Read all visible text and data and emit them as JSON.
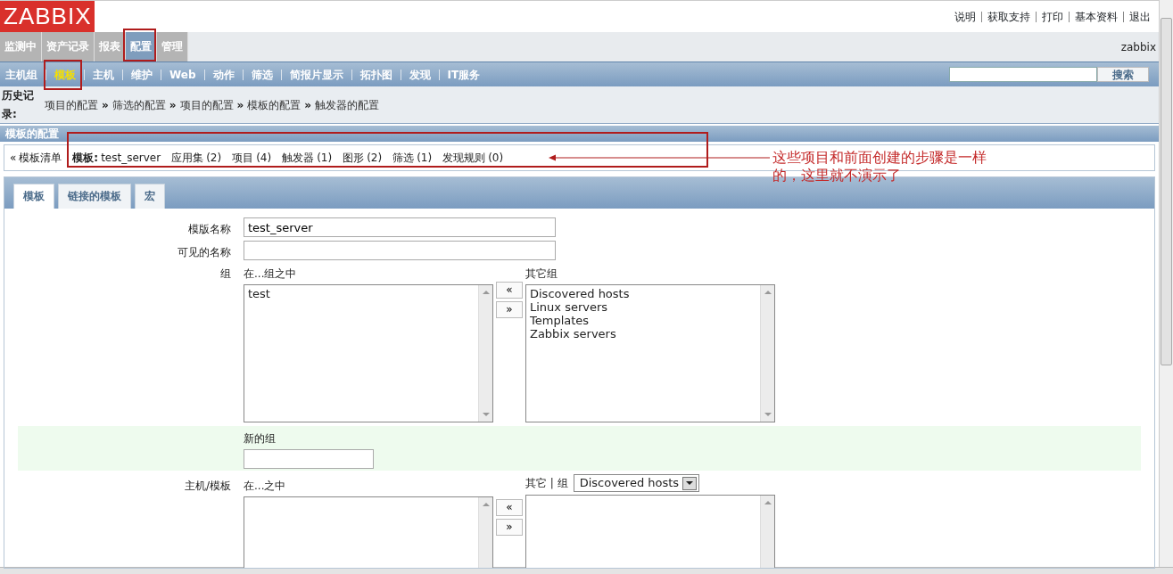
{
  "header": {
    "logo": "ZABBIX",
    "top_links": [
      "说明",
      "获取支持",
      "打印",
      "基本资料",
      "退出"
    ]
  },
  "main_menu": {
    "items": [
      {
        "label": "监测中",
        "selected": false
      },
      {
        "label": "资产记录",
        "selected": false
      },
      {
        "label": "报表",
        "selected": false
      },
      {
        "label": "配置",
        "selected": true
      },
      {
        "label": "管理",
        "selected": false
      }
    ],
    "user": "zabbix"
  },
  "sub_menu": {
    "items": [
      {
        "label": "主机组",
        "selected": false
      },
      {
        "label": "模板",
        "selected": true
      },
      {
        "label": "主机",
        "selected": false
      },
      {
        "label": "维护",
        "selected": false
      },
      {
        "label": "Web",
        "selected": false
      },
      {
        "label": "动作",
        "selected": false
      },
      {
        "label": "筛选",
        "selected": false
      },
      {
        "label": "简报片显示",
        "selected": false
      },
      {
        "label": "拓扑图",
        "selected": false
      },
      {
        "label": "发现",
        "selected": false
      },
      {
        "label": "IT服务",
        "selected": false
      }
    ],
    "search_button": "搜索"
  },
  "history": {
    "label": "历史记录:",
    "separator": "»",
    "items": [
      "项目的配置",
      "筛选的配置",
      "项目的配置",
      "模板的配置",
      "触发器的配置"
    ]
  },
  "section_title": "模板的配置",
  "template_nav": {
    "back_arrow": "«",
    "back_link": "模板清单",
    "template_label": "模板:",
    "template_name": "test_server",
    "links": [
      {
        "label": "应用集",
        "count": "(2)"
      },
      {
        "label": "项目",
        "count": "(4)"
      },
      {
        "label": "触发器",
        "count": "(1)"
      },
      {
        "label": "图形",
        "count": "(2)"
      },
      {
        "label": "筛选",
        "count": "(1)"
      },
      {
        "label": "发现规则",
        "count": "(0)"
      }
    ]
  },
  "annotation": "这些项目和前面创建的步骤是一样的，这里就不演示了",
  "form_tabs": [
    {
      "label": "模板",
      "selected": true
    },
    {
      "label": "链接的模板",
      "selected": false
    },
    {
      "label": "宏",
      "selected": false
    }
  ],
  "form": {
    "template_name": {
      "label": "模版名称",
      "value": "test_server"
    },
    "visible_name": {
      "label": "可见的名称"
    },
    "groups": {
      "label": "组",
      "in_label": "在...组之中",
      "in_items": [
        "test"
      ],
      "other_label": "其它组",
      "other_items": [
        "Discovered hosts",
        "Linux servers",
        "Templates",
        "Zabbix servers"
      ],
      "add_button": "«",
      "remove_button": "»"
    },
    "new_group": {
      "label": "新的组"
    },
    "hosts": {
      "label": "主机/模板",
      "in_label": "在...之中",
      "other_label": "其它 | 组",
      "group_select": "Discovered hosts",
      "add_button": "«",
      "remove_button": "»"
    }
  }
}
